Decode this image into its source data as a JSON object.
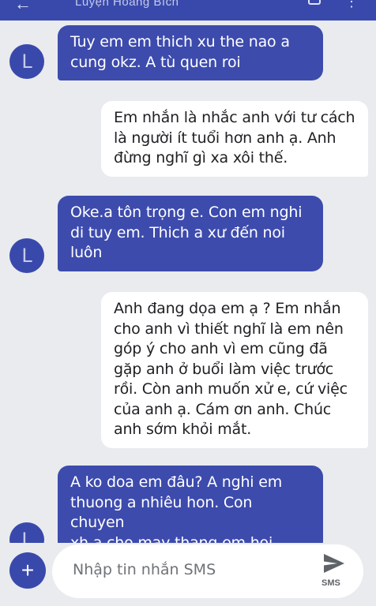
{
  "header": {
    "title": "Luyện Hoàng Bích"
  },
  "contact": {
    "initial": "L"
  },
  "messages": [
    {
      "direction": "incoming",
      "text": "Tuy em em thich xu the nao a\ncung okz. A tù quen roi"
    },
    {
      "direction": "outgoing",
      "text": "Em nhắn là nhắc anh với tư cách\nlà người ít tuổi hơn anh ạ. Anh\nđừng nghĩ gì xa xôi thế."
    },
    {
      "direction": "incoming",
      "text": "Oke.a tôn trọng e. Con em nghi\ndi tuy em. Thich a xư đến noi\nluôn"
    },
    {
      "direction": "outgoing",
      "text": "Anh đang dọa em ạ ? Em nhắn\ncho anh vì thiết nghĩ là em nên\ngóp ý cho anh vì em cũng đã\ngặp anh ở buổi làm việc trước\nrồi. Còn anh muốn xử e, cứ việc\ncủa anh ạ. Cám ơn anh. Chúc\nanh sớm khỏi mắt."
    },
    {
      "direction": "incoming",
      "text": "A ko doa em đâu? A nghi em\nthuong a nhiêu hon. Con chuyen\nxh a cho may thang em hoi tham\nchi"
    }
  ],
  "composer": {
    "placeholder": "Nhập tin nhắn SMS",
    "send_label": "SMS"
  },
  "colors": {
    "accent": "#3949ab",
    "incoming_bubble": "#3d4bad",
    "outgoing_bubble": "#ffffff",
    "background": "#e9ebee"
  }
}
